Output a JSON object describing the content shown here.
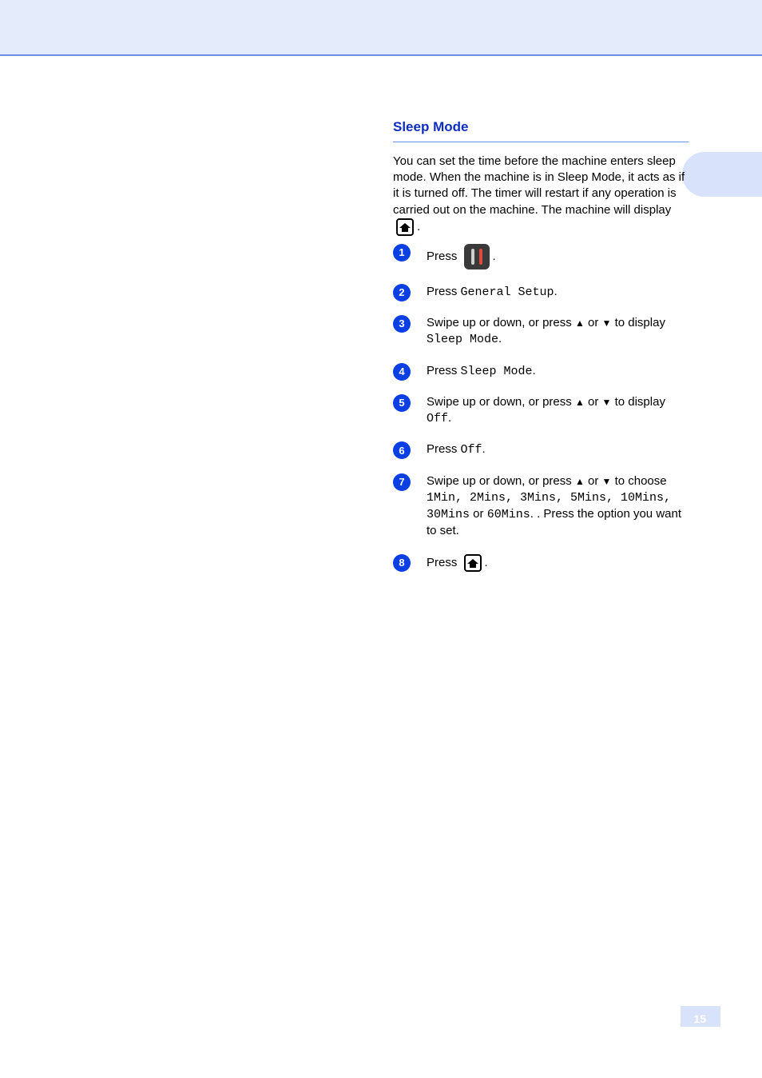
{
  "section": {
    "title": "Sleep Mode",
    "intro_before_icon": "You can set the time before the machine enters sleep mode. When the machine is in Sleep Mode, it acts as if it is turned off. The timer will restart if any operation is carried out on the machine. The machine will display ",
    "intro_after_icon": "."
  },
  "steps": [
    {
      "n": "1",
      "before": "Press ",
      "has_settings_icon": true,
      "after": "."
    },
    {
      "n": "2",
      "before": "Press ",
      "code": "General Setup",
      "after": "."
    },
    {
      "n": "3",
      "before": "Swipe up or down, or press ",
      "arrows": true,
      "after": " to display ",
      "code": "Sleep Mode",
      "after2": "."
    },
    {
      "n": "4",
      "before": "Press ",
      "code": "Sleep Mode",
      "after": "."
    },
    {
      "n": "5",
      "before": "Swipe up or down, or press ",
      "arrows": true,
      "after": " to display ",
      "code": "Off",
      "after2": "."
    },
    {
      "n": "6",
      "before": "Press ",
      "code": "Off",
      "after": "."
    },
    {
      "n": "7",
      "before": "Swipe up or down, or press ",
      "arrows": true,
      "after": " to choose ",
      "code_list": "1Min, 2Mins, 3Mins, 5Mins, 10Mins, 30Mins",
      "mid": " or ",
      "code_end": "60Mins",
      "after2": ". Press the option you want to set."
    },
    {
      "n": "8",
      "before": "Press ",
      "has_home_icon": true,
      "after": "."
    }
  ],
  "arrows": {
    "up": "▲",
    "down": "▼"
  },
  "page_number": "15"
}
